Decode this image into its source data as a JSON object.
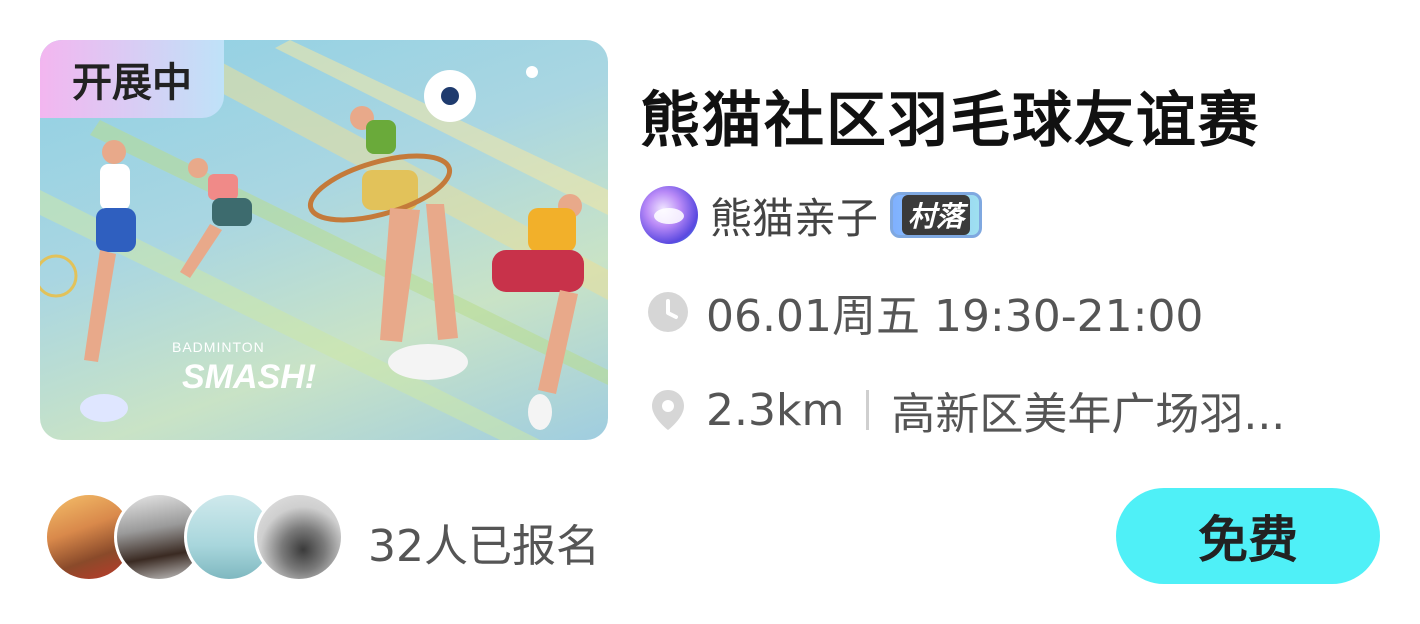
{
  "event": {
    "status_badge": "开展中",
    "title": "熊猫社区羽毛球友谊赛",
    "cover": {
      "text_line1": "BADMINTON",
      "text_line2": "SMASH!"
    },
    "organizer": {
      "name": "熊猫亲子",
      "tag": "村落"
    },
    "time": "06.01周五 19:30-21:00",
    "distance": "2.3km",
    "location": "高新区美年广场羽...",
    "signup_count": "32人已报名",
    "price_label": "免费"
  },
  "colors": {
    "price_button": "#4ff0f7",
    "status_badge_start": "#f3b6f0",
    "status_badge_end": "#bfe2f8"
  },
  "icons": {
    "time": "clock-icon",
    "location": "location-pin-icon"
  }
}
